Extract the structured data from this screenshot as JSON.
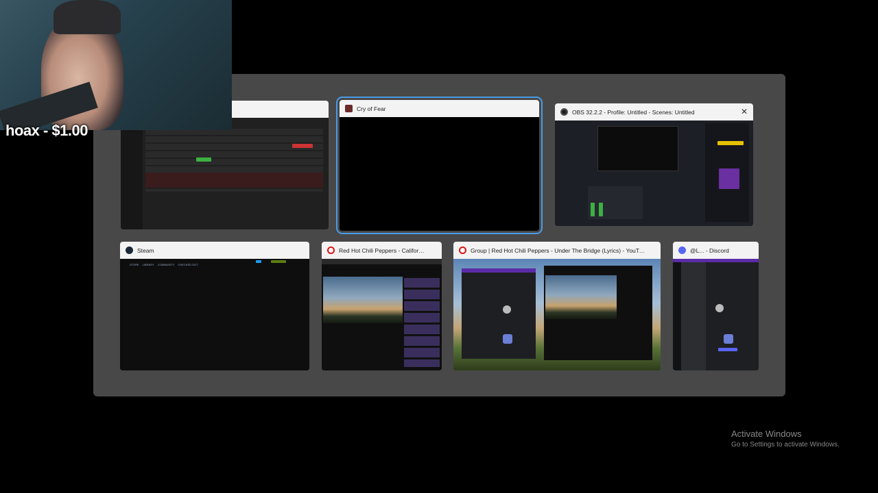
{
  "overlay": {
    "donation_text": "hoax - $1.00"
  },
  "switcher": {
    "windows": [
      {
        "title": "",
        "icon": "mixer-app-icon"
      },
      {
        "title": "Cry of Fear",
        "icon": "cry-of-fear-icon",
        "selected": true
      },
      {
        "title": "OBS 32.2.2 - Profile: Untitled - Scenes: Untitled",
        "icon": "obs-icon",
        "close": "✕"
      },
      {
        "title": "Steam",
        "icon": "steam-icon",
        "nav": [
          "STORE",
          "LIBRARY",
          "COMMUNITY",
          "CHECKED OUT"
        ]
      },
      {
        "title": "Red Hot Chili Peppers - Californication...",
        "icon": "opera-icon"
      },
      {
        "title": "Group | Red Hot Chili Peppers - Under The Bridge (Lyrics) - YouTube - Oper...",
        "icon": "opera-icon"
      },
      {
        "title": "@L... - Discord",
        "icon": "discord-icon"
      }
    ]
  },
  "watermark": {
    "heading": "Activate Windows",
    "subtext": "Go to Settings to activate Windows."
  },
  "colors": {
    "selection": "#4a9be8",
    "switcher_bg": "#484848",
    "titlebar": "#f3f3f3"
  }
}
